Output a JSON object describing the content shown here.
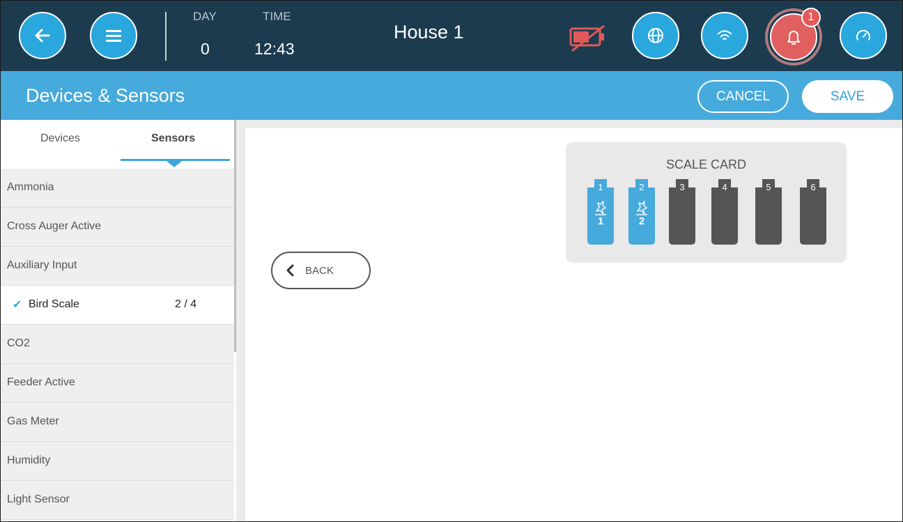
{
  "header": {
    "day_label": "DAY",
    "day_value": "0",
    "time_label": "TIME",
    "time_value": "12:43",
    "house_name": "House 1",
    "alarm_count": "1",
    "icons": [
      "back-arrow-icon",
      "menu-icon",
      "battery-off-icon",
      "globe-icon",
      "wifi-icon",
      "bell-icon",
      "gauge-icon"
    ],
    "colors": {
      "bar": "#1d3b4f",
      "button": "#2aa7dc",
      "battery_off": "#e05a5a",
      "badge": "#e35a5a"
    }
  },
  "titlebar": {
    "title": "Devices & Sensors",
    "cancel_label": "CANCEL",
    "save_label": "SAVE",
    "color": "#46aadc"
  },
  "sidebar": {
    "tabs": [
      {
        "label": "Devices",
        "active": false
      },
      {
        "label": "Sensors",
        "active": true
      }
    ],
    "items": [
      {
        "label": "Ammonia"
      },
      {
        "label": "Cross Auger Active"
      },
      {
        "label": "Auxiliary Input"
      },
      {
        "label": "Bird Scale",
        "count": "2 / 4",
        "selected": true
      },
      {
        "label": "CO2"
      },
      {
        "label": "Feeder Active"
      },
      {
        "label": "Gas Meter"
      },
      {
        "label": "Humidity"
      },
      {
        "label": "Light Sensor"
      }
    ]
  },
  "main": {
    "back_label": "BACK",
    "card": {
      "title": "SCALE CARD",
      "slots": [
        {
          "number": "1",
          "assigned": true,
          "scale": "1"
        },
        {
          "number": "2",
          "assigned": true,
          "scale": "2"
        },
        {
          "number": "3",
          "assigned": false
        },
        {
          "number": "4",
          "assigned": false
        },
        {
          "number": "5",
          "assigned": false
        },
        {
          "number": "6",
          "assigned": false
        }
      ],
      "colors": {
        "assigned": "#46aadc",
        "empty": "#555555"
      }
    }
  }
}
